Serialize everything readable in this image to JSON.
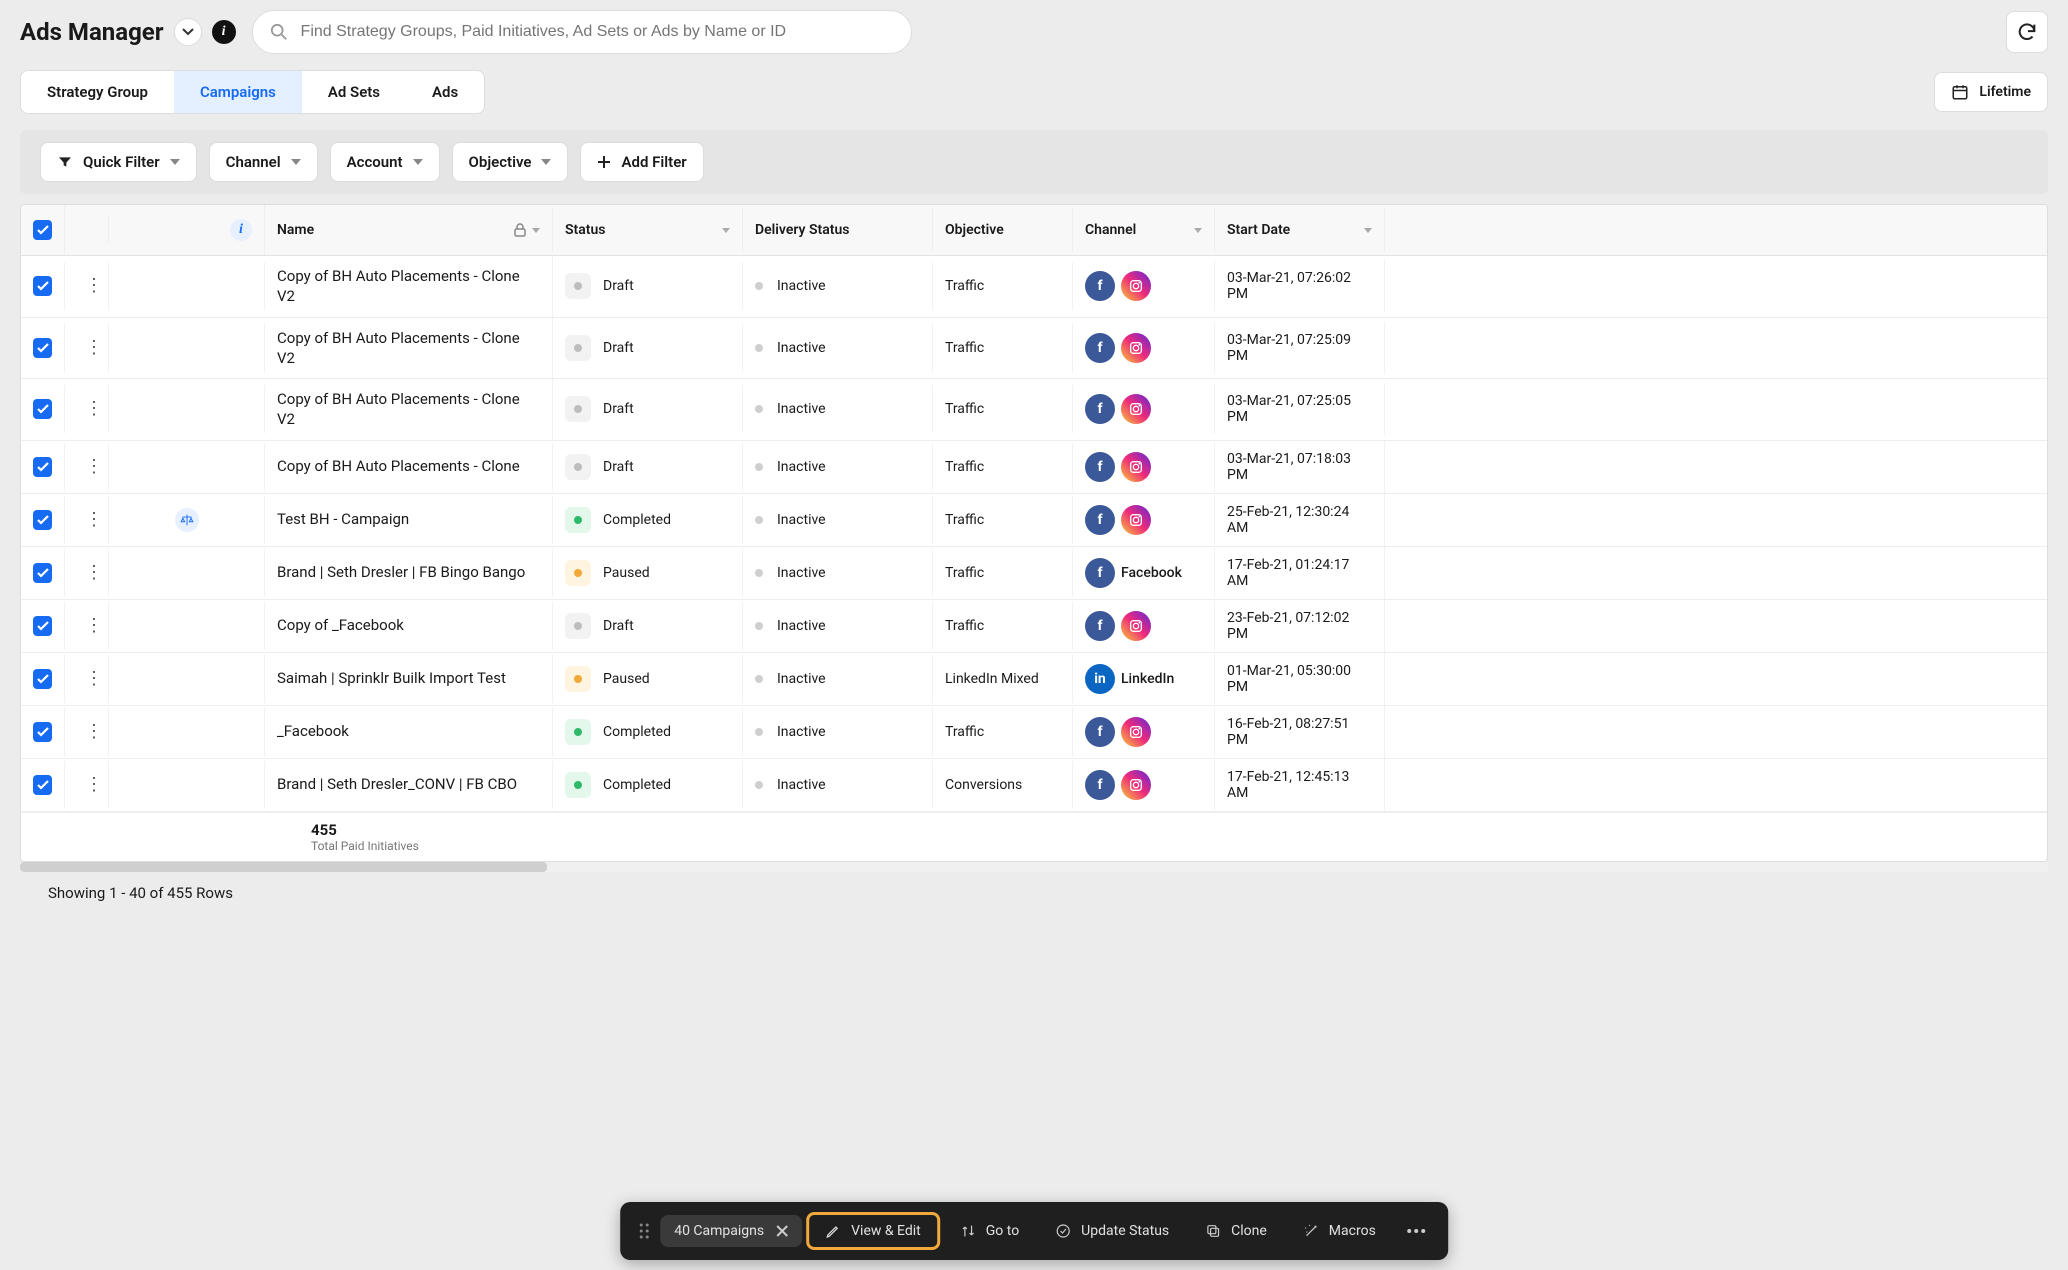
{
  "header": {
    "title": "Ads Manager",
    "search_placeholder": "Find Strategy Groups, Paid Initiatives, Ad Sets or Ads by Name or ID"
  },
  "tabs": {
    "items": [
      "Strategy Group",
      "Campaigns",
      "Ad Sets",
      "Ads"
    ],
    "active_index": 1,
    "date_range_label": "Lifetime"
  },
  "filters": {
    "quick_filter": "Quick Filter",
    "channel": "Channel",
    "account": "Account",
    "objective": "Objective",
    "add_filter": "Add Filter"
  },
  "columns": {
    "name": "Name",
    "status": "Status",
    "delivery_status": "Delivery Status",
    "objective": "Objective",
    "channel": "Channel",
    "start_date": "Start Date"
  },
  "rows": [
    {
      "name": "Copy of BH Auto Placements - Clone V2",
      "status": "Draft",
      "status_kind": "draft",
      "delivery": "Inactive",
      "objective": "Traffic",
      "channels": [
        "fb",
        "ig"
      ],
      "channel_label": "",
      "start": "03-Mar-21, 07:26:02 PM",
      "badge": ""
    },
    {
      "name": "Copy of BH Auto Placements - Clone V2",
      "status": "Draft",
      "status_kind": "draft",
      "delivery": "Inactive",
      "objective": "Traffic",
      "channels": [
        "fb",
        "ig"
      ],
      "channel_label": "",
      "start": "03-Mar-21, 07:25:09 PM",
      "badge": ""
    },
    {
      "name": "Copy of BH Auto Placements - Clone V2",
      "status": "Draft",
      "status_kind": "draft",
      "delivery": "Inactive",
      "objective": "Traffic",
      "channels": [
        "fb",
        "ig"
      ],
      "channel_label": "",
      "start": "03-Mar-21, 07:25:05 PM",
      "badge": ""
    },
    {
      "name": "Copy of BH Auto Placements - Clone",
      "status": "Draft",
      "status_kind": "draft",
      "delivery": "Inactive",
      "objective": "Traffic",
      "channels": [
        "fb",
        "ig"
      ],
      "channel_label": "",
      "start": "03-Mar-21, 07:18:03 PM",
      "badge": ""
    },
    {
      "name": "Test BH - Campaign",
      "status": "Completed",
      "status_kind": "completed",
      "delivery": "Inactive",
      "objective": "Traffic",
      "channels": [
        "fb",
        "ig"
      ],
      "channel_label": "",
      "start": "25-Feb-21, 12:30:24 AM",
      "badge": "scales"
    },
    {
      "name": "Brand | Seth Dresler | FB Bingo Bango",
      "status": "Paused",
      "status_kind": "paused",
      "delivery": "Inactive",
      "objective": "Traffic",
      "channels": [
        "fb"
      ],
      "channel_label": "Facebook",
      "start": "17-Feb-21, 01:24:17 AM",
      "badge": ""
    },
    {
      "name": "Copy of _Facebook",
      "status": "Draft",
      "status_kind": "draft",
      "delivery": "Inactive",
      "objective": "Traffic",
      "channels": [
        "fb",
        "ig"
      ],
      "channel_label": "",
      "start": "23-Feb-21, 07:12:02 PM",
      "badge": ""
    },
    {
      "name": "Saimah | Sprinklr Builk Import Test",
      "status": "Paused",
      "status_kind": "paused",
      "delivery": "Inactive",
      "objective": "LinkedIn Mixed",
      "channels": [
        "li"
      ],
      "channel_label": "LinkedIn",
      "start": "01-Mar-21, 05:30:00 PM",
      "badge": ""
    },
    {
      "name": "_Facebook",
      "status": "Completed",
      "status_kind": "completed",
      "delivery": "Inactive",
      "objective": "Traffic",
      "channels": [
        "fb",
        "ig"
      ],
      "channel_label": "",
      "start": "16-Feb-21, 08:27:51 PM",
      "badge": ""
    },
    {
      "name": "Brand | Seth Dresler_CONV | FB CBO",
      "status": "Completed",
      "status_kind": "completed",
      "delivery": "Inactive",
      "objective": "Conversions",
      "channels": [
        "fb",
        "ig"
      ],
      "channel_label": "",
      "start": "17-Feb-21, 12:45:13 AM",
      "badge": ""
    }
  ],
  "footer": {
    "total_count": "455",
    "total_label": "Total Paid Initiatives"
  },
  "pager": {
    "text": "Showing 1 - 40 of 455 Rows"
  },
  "action_bar": {
    "count_label": "40 Campaigns",
    "view_edit": "View & Edit",
    "go_to": "Go to",
    "update_status": "Update Status",
    "clone": "Clone",
    "macros": "Macros"
  }
}
